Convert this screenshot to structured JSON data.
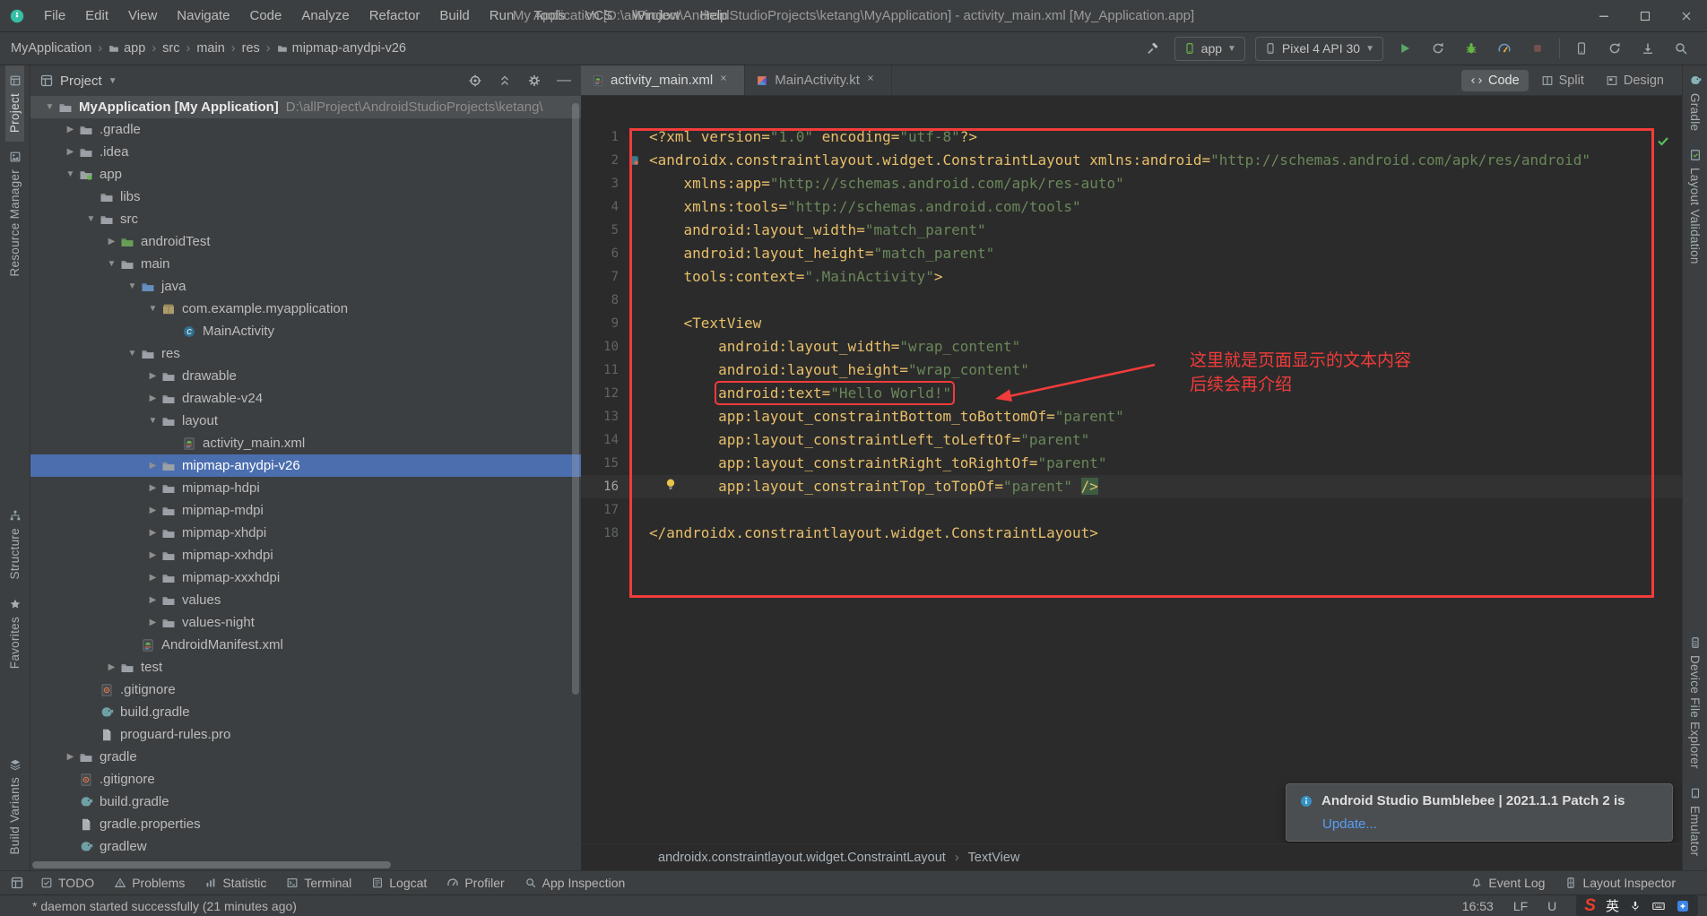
{
  "titlebar": {
    "title": "My Application [D:\\allProject\\AndroidStudioProjects\\ketang\\MyApplication] - activity_main.xml [My_Application.app]",
    "menus": [
      "File",
      "Edit",
      "View",
      "Navigate",
      "Code",
      "Analyze",
      "Refactor",
      "Build",
      "Run",
      "Tools",
      "VCS",
      "Window",
      "Help"
    ]
  },
  "toolbar": {
    "breadcrumbs": [
      {
        "label": "MyApplication",
        "icon": null
      },
      {
        "label": "app",
        "icon": "folder"
      },
      {
        "label": "src",
        "icon": null
      },
      {
        "label": "main",
        "icon": null
      },
      {
        "label": "res",
        "icon": null
      },
      {
        "label": "mipmap-anydpi-v26",
        "icon": "folder"
      }
    ],
    "run_config_label": "app",
    "device_label": "Pixel 4 API 30"
  },
  "left_stripe": {
    "groups": [
      [
        {
          "label": "Project",
          "icon": "project",
          "active": true
        },
        {
          "label": "Resource Manager",
          "icon": "resource",
          "active": false
        }
      ],
      [
        {
          "label": "Structure",
          "icon": "structure",
          "active": false
        },
        {
          "label": "Favorites",
          "icon": "star",
          "active": false
        }
      ],
      [
        {
          "label": "Build Variants",
          "icon": "variants",
          "active": false
        }
      ]
    ]
  },
  "right_stripe": {
    "groups": [
      [
        {
          "label": "Gradle",
          "icon": "elephant",
          "active": false
        },
        {
          "label": "Layout Validation",
          "icon": "layout-validation",
          "active": false
        }
      ],
      [
        {
          "label": "Device File Explorer",
          "icon": "device-explorer",
          "active": false
        },
        {
          "label": "Emulator",
          "icon": "emulator",
          "active": false
        }
      ]
    ]
  },
  "project_panel": {
    "header": {
      "title": "Project"
    },
    "tree": [
      {
        "lvl": 0,
        "chev": "v",
        "icon": "folder",
        "label": "MyApplication [My Application]",
        "suffix": "D:\\allProject\\AndroidStudioProjects\\ketang\\",
        "root": true
      },
      {
        "lvl": 1,
        "chev": ">",
        "icon": "folder",
        "label": ".gradle"
      },
      {
        "lvl": 1,
        "chev": ">",
        "icon": "folder",
        "label": ".idea"
      },
      {
        "lvl": 1,
        "chev": "v",
        "icon": "module",
        "label": "app"
      },
      {
        "lvl": 2,
        "chev": null,
        "icon": "folder",
        "label": "libs"
      },
      {
        "lvl": 2,
        "chev": "v",
        "icon": "folder",
        "label": "src"
      },
      {
        "lvl": 3,
        "chev": ">",
        "icon": "folder-green",
        "label": "androidTest"
      },
      {
        "lvl": 3,
        "chev": "v",
        "icon": "folder",
        "label": "main"
      },
      {
        "lvl": 4,
        "chev": "v",
        "icon": "folder-blue",
        "label": "java"
      },
      {
        "lvl": 5,
        "chev": "v",
        "icon": "package",
        "label": "com.example.myapplication"
      },
      {
        "lvl": 6,
        "chev": null,
        "icon": "class",
        "label": "MainActivity"
      },
      {
        "lvl": 4,
        "chev": "v",
        "icon": "folder",
        "label": "res"
      },
      {
        "lvl": 5,
        "chev": ">",
        "icon": "folder",
        "label": "drawable"
      },
      {
        "lvl": 5,
        "chev": ">",
        "icon": "folder",
        "label": "drawable-v24"
      },
      {
        "lvl": 5,
        "chev": "v",
        "icon": "folder",
        "label": "layout"
      },
      {
        "lvl": 6,
        "chev": null,
        "icon": "android-file",
        "label": "activity_main.xml"
      },
      {
        "lvl": 5,
        "chev": ">",
        "icon": "folder",
        "label": "mipmap-anydpi-v26",
        "selected": true
      },
      {
        "lvl": 5,
        "chev": ">",
        "icon": "folder",
        "label": "mipmap-hdpi"
      },
      {
        "lvl": 5,
        "chev": ">",
        "icon": "folder",
        "label": "mipmap-mdpi"
      },
      {
        "lvl": 5,
        "chev": ">",
        "icon": "folder",
        "label": "mipmap-xhdpi"
      },
      {
        "lvl": 5,
        "chev": ">",
        "icon": "folder",
        "label": "mipmap-xxhdpi"
      },
      {
        "lvl": 5,
        "chev": ">",
        "icon": "folder",
        "label": "mipmap-xxxhdpi"
      },
      {
        "lvl": 5,
        "chev": ">",
        "icon": "folder",
        "label": "values"
      },
      {
        "lvl": 5,
        "chev": ">",
        "icon": "folder",
        "label": "values-night"
      },
      {
        "lvl": 4,
        "chev": null,
        "icon": "android-file",
        "label": "AndroidManifest.xml"
      },
      {
        "lvl": 3,
        "chev": ">",
        "icon": "folder",
        "label": "test"
      },
      {
        "lvl": 2,
        "chev": null,
        "icon": "git-file",
        "label": ".gitignore"
      },
      {
        "lvl": 2,
        "chev": null,
        "icon": "gradle",
        "label": "build.gradle"
      },
      {
        "lvl": 2,
        "chev": null,
        "icon": "file",
        "label": "proguard-rules.pro"
      },
      {
        "lvl": 1,
        "chev": ">",
        "icon": "folder",
        "label": "gradle"
      },
      {
        "lvl": 1,
        "chev": null,
        "icon": "git-file",
        "label": ".gitignore"
      },
      {
        "lvl": 1,
        "chev": null,
        "icon": "gradle",
        "label": "build.gradle"
      },
      {
        "lvl": 1,
        "chev": null,
        "icon": "file",
        "label": "gradle.properties"
      },
      {
        "lvl": 1,
        "chev": null,
        "icon": "gradle",
        "label": "gradlew"
      }
    ]
  },
  "editor": {
    "tabs": [
      {
        "label": "activity_main.xml",
        "icon": "android-file",
        "active": true
      },
      {
        "label": "MainActivity.kt",
        "icon": "kotlin-file",
        "active": false
      }
    ],
    "view_modes": [
      {
        "label": "Code",
        "icon": "code-view",
        "active": true
      },
      {
        "label": "Split",
        "icon": "split-view",
        "active": false
      },
      {
        "label": "Design",
        "icon": "design-view",
        "active": false
      }
    ],
    "lines": [
      {
        "n": 1,
        "t": [
          [
            "y",
            "<?xml version="
          ],
          [
            "s",
            "\"1.0\""
          ],
          [
            "y",
            " encoding="
          ],
          [
            "s",
            "\"utf-8\""
          ],
          [
            "y",
            "?>"
          ]
        ]
      },
      {
        "n": 2,
        "g": "layout-gutter",
        "t": [
          [
            "y",
            "<androidx.constraintlayout.widget.ConstraintLayout xmlns:android="
          ],
          [
            "s",
            "\"http://schemas.android.com/apk/res/android\""
          ]
        ]
      },
      {
        "n": 3,
        "t": [
          [
            "y",
            "    xmlns:app="
          ],
          [
            "s",
            "\"http://schemas.android.com/apk/res-auto\""
          ]
        ]
      },
      {
        "n": 4,
        "t": [
          [
            "y",
            "    xmlns:tools="
          ],
          [
            "s",
            "\"http://schemas.android.com/tools\""
          ]
        ]
      },
      {
        "n": 5,
        "t": [
          [
            "y",
            "    android:layout_width="
          ],
          [
            "s",
            "\"match_parent\""
          ]
        ]
      },
      {
        "n": 6,
        "t": [
          [
            "y",
            "    android:layout_height="
          ],
          [
            "s",
            "\"match_parent\""
          ]
        ]
      },
      {
        "n": 7,
        "t": [
          [
            "y",
            "    tools:context="
          ],
          [
            "s",
            "\".MainActivity\""
          ],
          [
            "y",
            ">"
          ]
        ]
      },
      {
        "n": 8,
        "t": []
      },
      {
        "n": 9,
        "t": [
          [
            "y",
            "    <TextView"
          ]
        ]
      },
      {
        "n": 10,
        "t": [
          [
            "y",
            "        android:layout_width="
          ],
          [
            "s",
            "\"wrap_content\""
          ]
        ]
      },
      {
        "n": 11,
        "t": [
          [
            "y",
            "        android:layout_height="
          ],
          [
            "s",
            "\"wrap_content\""
          ]
        ]
      },
      {
        "n": 12,
        "redbox": true,
        "t": [
          [
            "y",
            "        "
          ],
          [
            "y",
            "android:text="
          ],
          [
            "s",
            "\"Hello World!\""
          ]
        ]
      },
      {
        "n": 13,
        "t": [
          [
            "y",
            "        app:layout_constraintBottom_toBottomOf="
          ],
          [
            "s",
            "\"parent\""
          ]
        ]
      },
      {
        "n": 14,
        "t": [
          [
            "y",
            "        app:layout_constraintLeft_toLeftOf="
          ],
          [
            "s",
            "\"parent\""
          ]
        ]
      },
      {
        "n": 15,
        "t": [
          [
            "y",
            "        app:layout_constraintRight_toRightOf="
          ],
          [
            "s",
            "\"parent\""
          ]
        ]
      },
      {
        "n": 16,
        "caret": true,
        "t": [
          [
            "y",
            "        app:layout_constraintTop_toTopOf="
          ],
          [
            "s",
            "\"parent\""
          ],
          [
            "d",
            " "
          ],
          [
            "h",
            "/>"
          ]
        ]
      },
      {
        "n": 17,
        "t": []
      },
      {
        "n": 18,
        "t": [
          [
            "y",
            "</androidx.constraintlayout.widget.ConstraintLayout>"
          ]
        ]
      }
    ],
    "breadcrumbs": [
      "androidx.constraintlayout.widget.ConstraintLayout",
      "TextView"
    ],
    "annotation": {
      "text_line1": "这里就是页面显示的文本内容",
      "text_line2": "后续会再介绍"
    },
    "notification": {
      "title": "Android Studio Bumblebee | 2021.1.1 Patch 2 is",
      "link": "Update..."
    }
  },
  "bottom_bar": {
    "left": [
      {
        "label": "TODO",
        "icon": "todo"
      },
      {
        "label": "Problems",
        "icon": "problems"
      },
      {
        "label": "Statistic",
        "icon": "statistic"
      },
      {
        "label": "Terminal",
        "icon": "terminal"
      },
      {
        "label": "Logcat",
        "icon": "logcat"
      },
      {
        "label": "Profiler",
        "icon": "profiler"
      },
      {
        "label": "App Inspection",
        "icon": "inspection"
      }
    ],
    "right": [
      {
        "label": "Event Log",
        "icon": "bell"
      },
      {
        "label": "Layout Inspector",
        "icon": "phone-grid"
      }
    ]
  },
  "status_bar": {
    "message": "* daemon started successfully (21 minutes ago)",
    "time": "16:53",
    "line_ending": "LF",
    "encoding": "U",
    "ime": {
      "logo": "S",
      "lang": "英"
    }
  }
}
